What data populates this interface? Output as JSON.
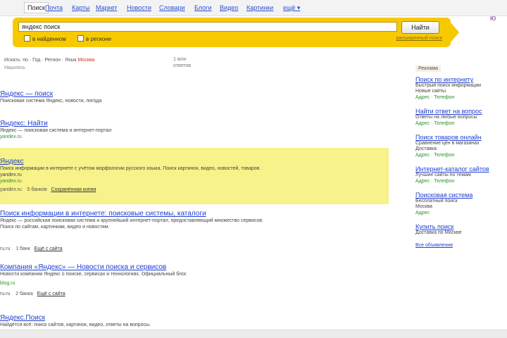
{
  "nav": {
    "tabs": [
      {
        "label": "Поиск",
        "active": true
      },
      {
        "label": "Почта"
      },
      {
        "label": "Карты"
      },
      {
        "label": "Маркет"
      },
      {
        "label": "Новости"
      },
      {
        "label": "Словари"
      },
      {
        "label": "Блоги"
      },
      {
        "label": "Видео"
      },
      {
        "label": "Картинки"
      },
      {
        "label": "ещё ▾"
      }
    ]
  },
  "search": {
    "query": "яндекс поиск",
    "button": "Найти",
    "options": [
      "в найденном",
      "в регионе"
    ],
    "advanced_link": "расширенный поиск"
  },
  "side_text": "ю",
  "filters": {
    "line": "Искать: по · Год · Регион · Язык",
    "accent": "Москва",
    "sub": "Нашлось",
    "stats": "1 млн\nответов"
  },
  "results": [
    {
      "title": "Яндекс — поиск",
      "snippet": "Поисковая система Яндекс, новости, погода",
      "url": "",
      "meta": ""
    },
    {
      "title": "Яндекс: Найти",
      "snippet": "Яндекс — поисковая система и интернет-портал",
      "url": "yandex.ru",
      "meta": ""
    },
    {
      "title": "Яндекс",
      "snippet": "Поиск информации в интернете с учётом морфологии русского языка. Поиск картинок, видео, новостей, товаров.",
      "snippet2": "yandex.ru",
      "url": "yandex.ru",
      "meta_a": "yandex.ru",
      "meta_b": "5 банков",
      "meta_link": "Сохранённая копия"
    },
    {
      "title": "Поиск информации в интернете: поисковые системы, каталоги",
      "snippet": "Яндекс — российская поисковая система и крупнейший интернет-портал, предоставляющий множество сервисов.",
      "snippet2": "Поиск по сайтам, картинкам, видео и новостям.",
      "url": "",
      "meta_a": "ru.ru",
      "meta_b": "1 банк",
      "meta_link": "Ещё с сайта"
    },
    {
      "title": "Компания «Яндекс» — Новости поиска и сервисов",
      "snippet": "Новости компании Яндекс о поиске, сервисах и технологиях. Официальный блог.",
      "snippet2": "",
      "url": "blog.ru",
      "meta_a": "ru.ru",
      "meta_b": "2 банка",
      "meta_link": "Ещё с сайта"
    },
    {
      "title": "Яндекс.Поиск",
      "snippet": "Найдётся всё: поиск сайтов, картинок, видео, ответы на вопросы.",
      "url": "",
      "meta": ""
    }
  ],
  "ads": {
    "label": "Реклама",
    "items": [
      {
        "title": "Поиск по интернету",
        "text": "Быстрый поиск информации",
        "text2": "Новые сайты",
        "link": "Адрес · Телефон"
      },
      {
        "title": "Найти ответ на вопрос",
        "text": "Ответы на любые вопросы",
        "text2": "",
        "link": "Адрес · Телефон"
      },
      {
        "title": "Поиск товаров онлайн",
        "text": "Сравнение цен в магазинах",
        "text2": "Доставка",
        "link": "Адрес · Телефон"
      },
      {
        "title": "Интернет-каталог сайтов",
        "text": "Лучшие сайты по темам",
        "text2": "",
        "link": "Адрес · Телефон"
      },
      {
        "title": "Поисковая система",
        "text": "Бесплатный поиск",
        "text2": "Москва",
        "link": "Адрес"
      },
      {
        "title": "Купить поиск",
        "text": "Доставка по Москве",
        "text2": "",
        "link": ""
      }
    ],
    "more": "Все объявления"
  }
}
